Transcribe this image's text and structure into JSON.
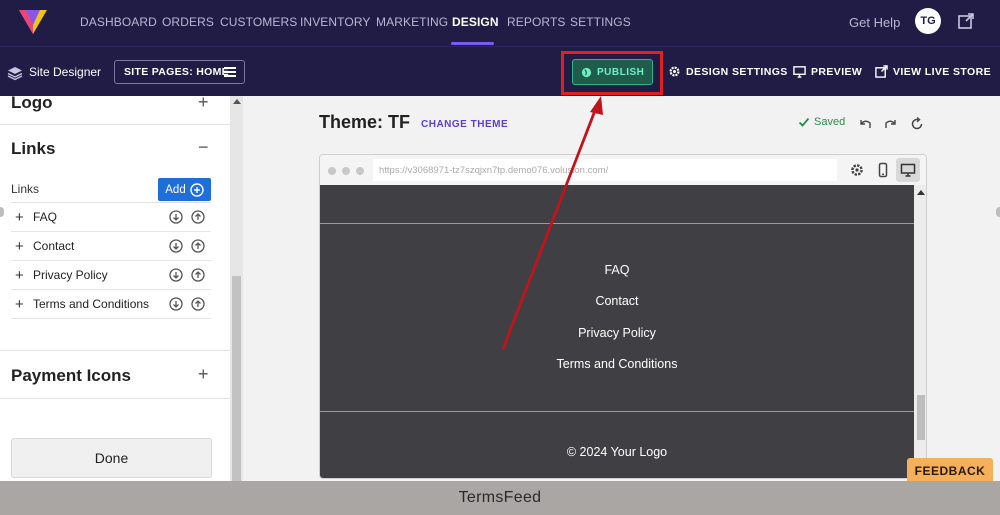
{
  "nav": {
    "items": [
      "DASHBOARD",
      "ORDERS",
      "CUSTOMERS",
      "INVENTORY",
      "MARKETING",
      "DESIGN",
      "REPORTS",
      "SETTINGS"
    ],
    "active": "DESIGN",
    "get_help": "Get Help",
    "avatar_initials": "TG"
  },
  "toolbar": {
    "site_designer": "Site Designer",
    "site_pages": "SITE PAGES: HOME",
    "publish": "PUBLISH",
    "design_settings": "DESIGN SETTINGS",
    "preview": "PREVIEW",
    "view_live_store": "VIEW LIVE STORE"
  },
  "left_panel": {
    "logo_section": "Logo",
    "links_section": "Links",
    "links_label": "Links",
    "add_button": "Add",
    "links": [
      "FAQ",
      "Contact",
      "Privacy Policy",
      "Terms and Conditions"
    ],
    "payment_icons_section": "Payment Icons",
    "done_button": "Done"
  },
  "main": {
    "theme_title": "Theme: TF",
    "change_theme": "CHANGE THEME",
    "saved": "Saved",
    "url": "https://v3068971-tz7szqjxn7tp.demo076.volusion.com/",
    "footer_links": [
      "FAQ",
      "Contact",
      "Privacy Policy",
      "Terms and Conditions"
    ],
    "copyright": "© 2024 Your Logo"
  },
  "feedback": "FEEDBACK",
  "watermark": "TermsFeed",
  "colors": {
    "nav_bg": "#201c45",
    "accent_purple": "#7b5cf0",
    "publish_green": "#2fb68a",
    "highlight_red": "#e02020",
    "add_blue": "#1e6fd9",
    "site_bg": "#403f43",
    "feedback_orange": "#f4b05a"
  }
}
